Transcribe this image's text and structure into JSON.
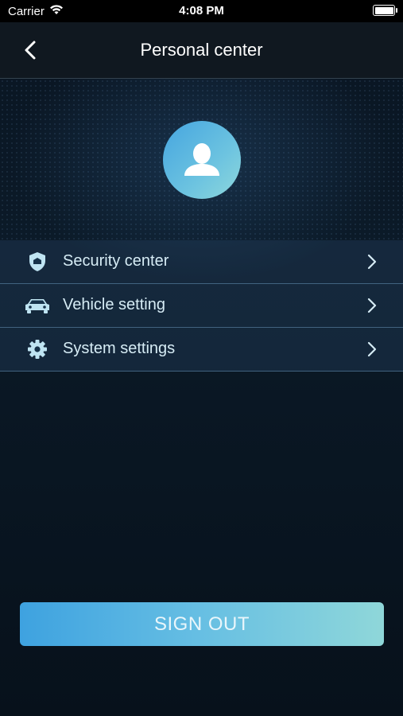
{
  "status_bar": {
    "carrier": "Carrier",
    "time": "4:08 PM"
  },
  "nav": {
    "title": "Personal center",
    "back_icon": "chevron-left-icon"
  },
  "profile": {
    "avatar_icon": "user-icon"
  },
  "menu": {
    "items": [
      {
        "label": "Security center",
        "icon": "shield-icon"
      },
      {
        "label": "Vehicle setting",
        "icon": "car-icon"
      },
      {
        "label": "System settings",
        "icon": "gear-icon"
      }
    ]
  },
  "signout_label": "SIGN OUT",
  "colors": {
    "accent_start": "#3ea2e0",
    "accent_end": "#8fd7d9",
    "icon": "#bfe4f2"
  }
}
